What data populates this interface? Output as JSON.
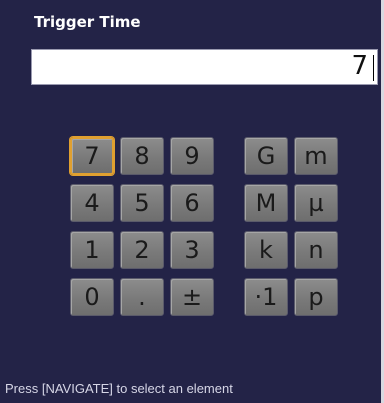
{
  "dialog": {
    "title": "Trigger Time",
    "entry_value": "7"
  },
  "keypad": {
    "digits": [
      "7",
      "8",
      "9",
      "4",
      "5",
      "6",
      "1",
      "2",
      "3",
      "0",
      ".",
      "±"
    ],
    "units": [
      "G",
      "m",
      "M",
      "µ",
      "k",
      "n",
      "·1",
      "p"
    ],
    "focused_key": "7"
  },
  "status_bar": {
    "message": "Press [NAVIGATE] to select an element"
  }
}
